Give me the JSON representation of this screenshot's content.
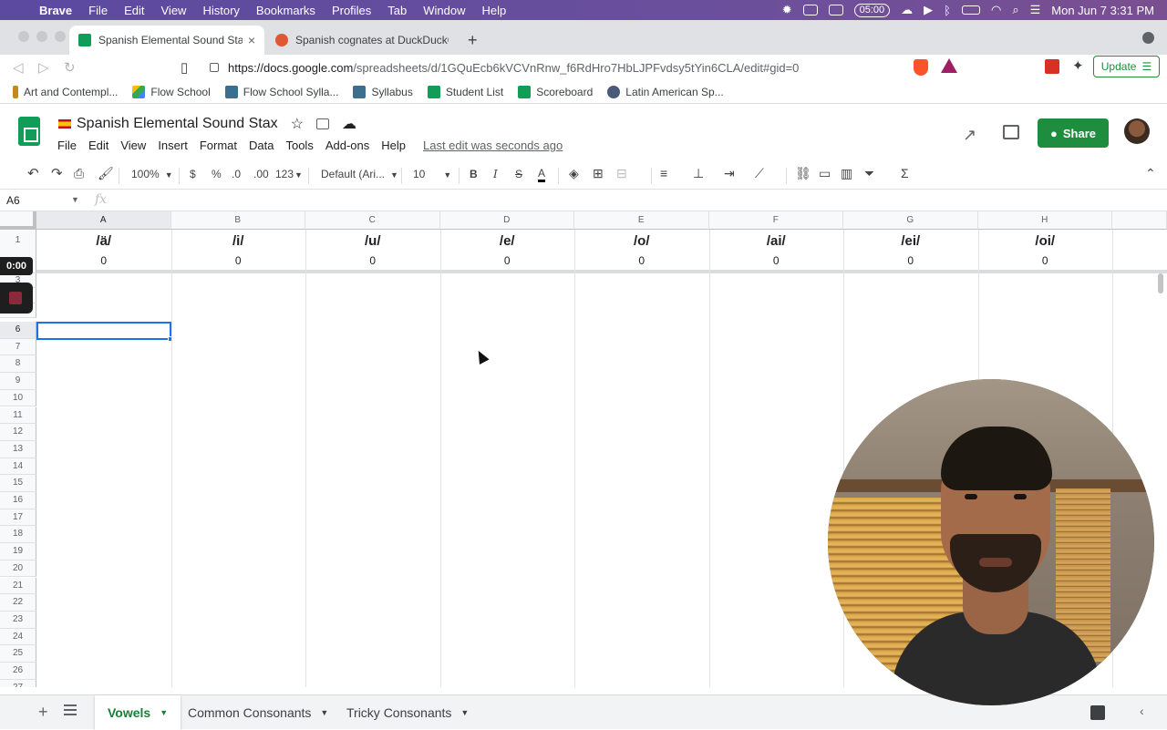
{
  "macbar": {
    "app": "Brave",
    "menus": [
      "File",
      "Edit",
      "View",
      "History",
      "Bookmarks",
      "Profiles",
      "Tab",
      "Window",
      "Help"
    ],
    "timer": "05:00",
    "datetime": "Mon Jun 7  3:31 PM"
  },
  "browser": {
    "tabs": [
      {
        "title": "Spanish Elemental Sound Stax"
      },
      {
        "title": "Spanish cognates at DuckDuckGo"
      }
    ],
    "url_host": "https://docs.google.com",
    "url_path": "/spreadsheets/d/1GQuEcb6kVCVnRnw_f6RdHro7HbLJPFvdsy5tYin6CLA/edit#gid=0",
    "update_label": "Update",
    "bookmarks": [
      "Art and Contempl...",
      "Flow School",
      "Flow School Sylla...",
      "Syllabus",
      "Student List",
      "Scoreboard",
      "Latin American Sp..."
    ]
  },
  "sheet": {
    "title": "Spanish Elemental Sound Stax",
    "menus": [
      "File",
      "Edit",
      "View",
      "Insert",
      "Format",
      "Data",
      "Tools",
      "Add-ons",
      "Help"
    ],
    "last_edit": "Last edit was seconds ago",
    "share_label": "Share",
    "toolbar": {
      "zoom": "100%",
      "currency": "$",
      "percent": "%",
      "dec_less": ".0",
      "dec_more": ".00",
      "more_formats": "123",
      "font": "Default (Ari...",
      "font_size": "10",
      "bold": "B",
      "italic": "I",
      "strike": "S",
      "text_color": "A"
    },
    "namebox": "A6",
    "fx": "fx",
    "columns": [
      "A",
      "B",
      "C",
      "D",
      "E",
      "F",
      "G",
      "H"
    ],
    "row1": [
      "/ä/",
      "/i/",
      "/u/",
      "/e/",
      "/o/",
      "/ai/",
      "/ei/",
      "/oi/"
    ],
    "row2": [
      "0",
      "0",
      "0",
      "0",
      "0",
      "0",
      "0",
      "0"
    ],
    "row_numbers": [
      "1",
      "3",
      "4",
      "5",
      "6",
      "7",
      "8",
      "9",
      "10",
      "11",
      "12",
      "13",
      "14",
      "15",
      "16",
      "17",
      "18",
      "19",
      "20",
      "21",
      "22",
      "23",
      "24",
      "25",
      "26",
      "27"
    ],
    "selected_cell": "A6",
    "tabs": [
      "Vowels",
      "Common Consonants",
      "Tricky Consonants"
    ],
    "active_tab": "Vowels"
  },
  "recorder": {
    "elapsed": "0:00"
  },
  "colors": {
    "accent_green": "#1e8e3e",
    "selection_blue": "#1a73e8",
    "mac_bar": "#5b4aa0"
  }
}
